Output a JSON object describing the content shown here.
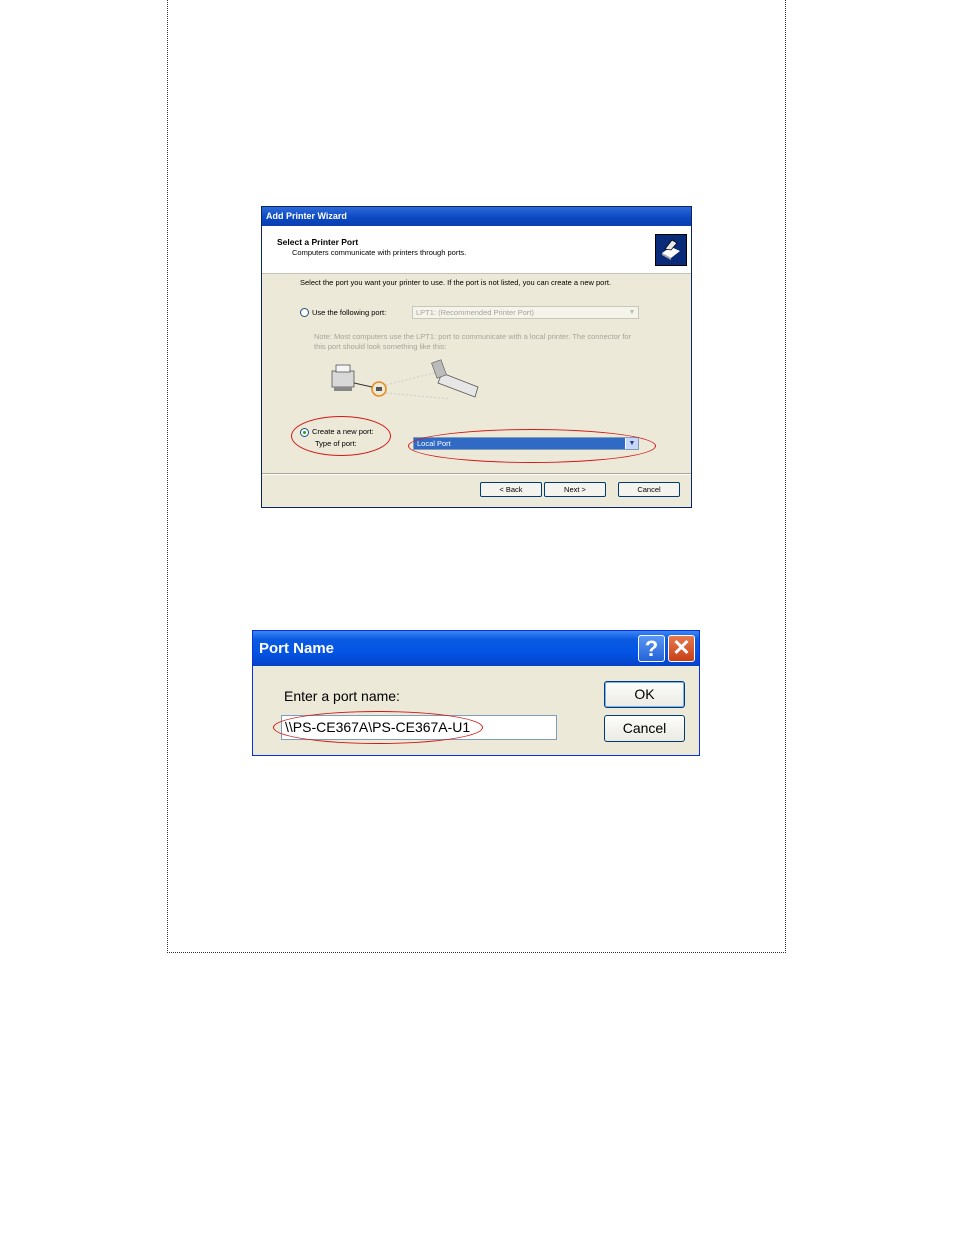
{
  "wizard": {
    "title": "Add Printer Wizard",
    "header_title": "Select a Printer Port",
    "header_subtitle": "Computers communicate with printers through ports.",
    "intro": "Select the port you want your printer to use.  If the port is not listed, you can create a new port.",
    "use_port_label": "Use the following port:",
    "use_port_value": "LPT1: (Recommended Printer Port)",
    "note": "Note: Most computers use the LPT1: port to communicate with a local printer. The connector for this port should look something like this:",
    "create_port_label": "Create a new port:",
    "type_of_port_label": "Type of port:",
    "type_of_port_value": "Local Port",
    "back_label": "< Back",
    "next_label": "Next >",
    "cancel_label": "Cancel",
    "selected_option": "create_new_port"
  },
  "port_dialog": {
    "title": "Port Name",
    "help_glyph": "?",
    "close_glyph": "✕",
    "prompt": "Enter a port name:",
    "port_value": "\\\\PS-CE367A\\PS-CE367A-U1",
    "ok_label": "OK",
    "cancel_label": "Cancel"
  },
  "colors": {
    "highlight_ellipse": "#d21818",
    "selection": "#316ac5",
    "titlebar": "#0454e6"
  }
}
